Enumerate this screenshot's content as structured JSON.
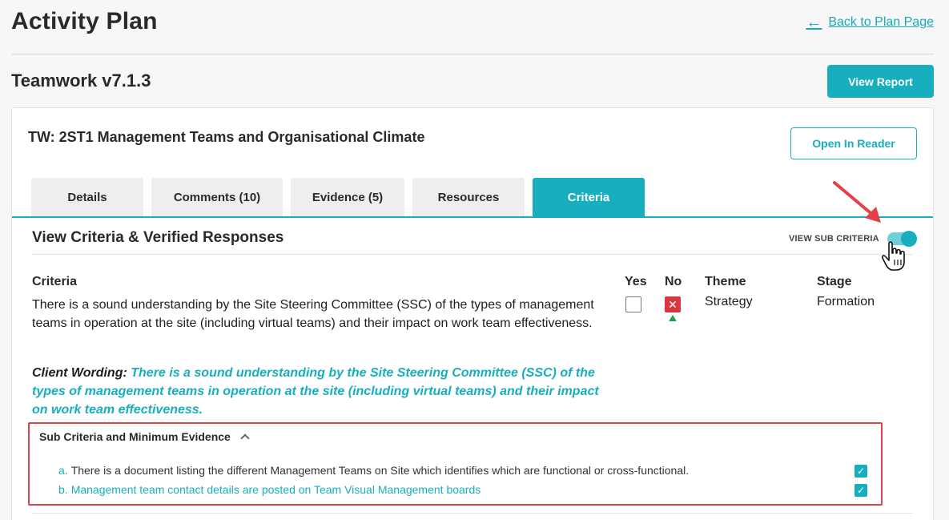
{
  "header": {
    "title": "Activity Plan",
    "back_link": "Back to Plan Page"
  },
  "plan": {
    "title": "Teamwork v7.1.3",
    "view_report_label": "View Report"
  },
  "activity": {
    "title": "TW: 2ST1 Management Teams and Organisational Climate",
    "open_reader_label": "Open In Reader"
  },
  "tabs": [
    {
      "label": "Details",
      "active": false
    },
    {
      "label": "Comments (10)",
      "active": false
    },
    {
      "label": "Evidence (5)",
      "active": false
    },
    {
      "label": "Resources",
      "active": false
    },
    {
      "label": "Criteria",
      "active": true
    }
  ],
  "criteria_section": {
    "title": "View Criteria & Verified Responses",
    "toggle_label": "VIEW SUB CRITERIA",
    "toggle_on": true,
    "columns": {
      "criteria": "Criteria",
      "yes": "Yes",
      "no": "No",
      "theme": "Theme",
      "stage": "Stage"
    },
    "row": {
      "criteria_text": "There is a sound understanding by the Site Steering Committee (SSC) of the types of management teams in operation at the site (including virtual teams) and their impact on work team effectiveness.",
      "yes_checked": false,
      "no_checked": true,
      "no_mark": "✕",
      "theme": "Strategy",
      "stage": "Formation"
    },
    "client_wording": {
      "label": "Client Wording:",
      "text": "There is a sound understanding by the Site Steering Committee (SSC) of the types of management teams in operation at the site (including virtual teams) and their impact on work team effectiveness."
    }
  },
  "sub_criteria": {
    "title": "Sub Criteria and Minimum Evidence",
    "items": [
      {
        "letter": "a.",
        "text": "There is a document listing the different Management Teams on Site which identifies which are functional or cross-functional.",
        "checked": true
      },
      {
        "letter": "b.",
        "text": "Management team contact details are posted on Team Visual Management boards",
        "checked": true
      }
    ],
    "check_mark": "✓"
  },
  "colors": {
    "accent": "#17aebd",
    "no_red": "#d9373f",
    "annotation_red": "#e2414a"
  }
}
